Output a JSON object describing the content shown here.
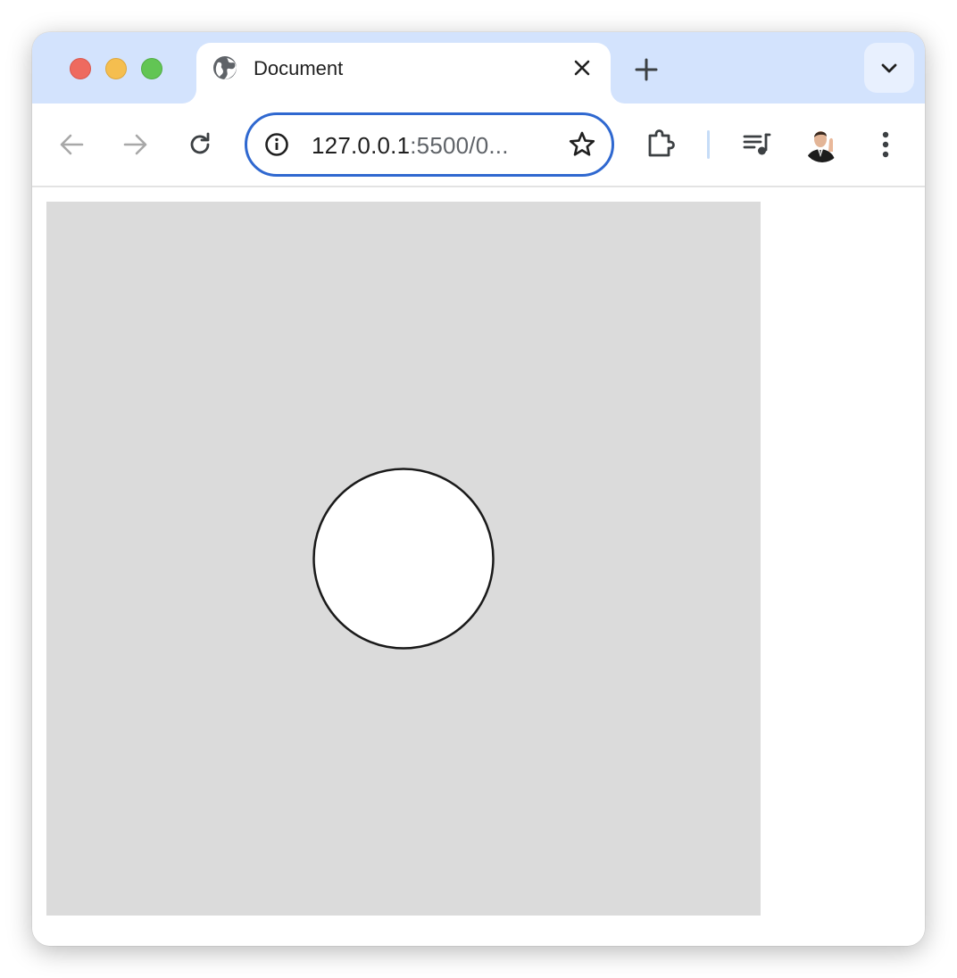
{
  "window": {
    "traffic_lights": {
      "close_color": "#ee6a5f",
      "minimize_color": "#f5be4f",
      "maximize_color": "#62c554"
    }
  },
  "tab": {
    "title": "Document",
    "favicon_icon": "globe-icon",
    "close_icon": "close-icon"
  },
  "new_tab_icon": "plus-icon",
  "tab_search_icon": "chevron-down-icon",
  "toolbar": {
    "back_icon": "arrow-left-icon",
    "forward_icon": "arrow-right-icon",
    "reload_icon": "reload-icon",
    "extensions_icon": "puzzle-icon",
    "media_icon": "playlist-music-icon",
    "menu_icon": "vertical-dots-icon"
  },
  "omnibox": {
    "url_host": "127.0.0.1",
    "url_path": ":5500/0...",
    "info_icon": "info-icon",
    "bookmark_icon": "star-icon"
  },
  "colors": {
    "tabstrip": "#d3e3fd",
    "omnibox_border": "#2f68d0",
    "canvas_background": "#dbdbdb",
    "circle_fill": "#ffffff",
    "circle_stroke": "#1a1a1a"
  }
}
